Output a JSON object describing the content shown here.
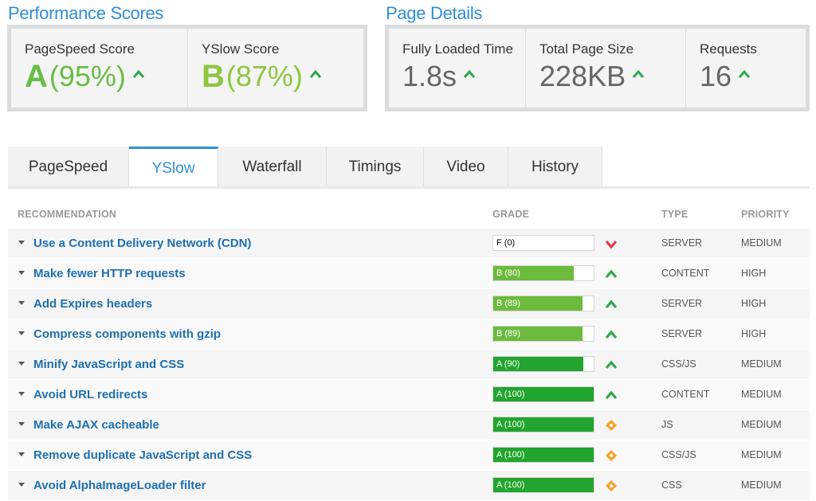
{
  "performance": {
    "title": "Performance Scores",
    "pagespeed": {
      "label": "PageSpeed Score",
      "grade": "A",
      "percent": "(95%)"
    },
    "yslow": {
      "label": "YSlow Score",
      "grade": "B",
      "percent": "(87%)"
    }
  },
  "details": {
    "title": "Page Details",
    "loaded": {
      "label": "Fully Loaded Time",
      "value": "1.8s"
    },
    "size": {
      "label": "Total Page Size",
      "value": "228KB"
    },
    "requests": {
      "label": "Requests",
      "value": "16"
    }
  },
  "tabs": [
    "PageSpeed",
    "YSlow",
    "Waterfall",
    "Timings",
    "Video",
    "History"
  ],
  "active_tab": "YSlow",
  "table": {
    "headers": {
      "recommendation": "RECOMMENDATION",
      "grade": "GRADE",
      "type": "TYPE",
      "priority": "PRIORITY"
    },
    "rows": [
      {
        "rec": "Use a Content Delivery Network (CDN)",
        "grade": "F (0)",
        "score": 0,
        "status": "down",
        "type": "SERVER",
        "priority": "MEDIUM"
      },
      {
        "rec": "Make fewer HTTP requests",
        "grade": "B (80)",
        "score": 80,
        "status": "up",
        "type": "CONTENT",
        "priority": "HIGH"
      },
      {
        "rec": "Add Expires headers",
        "grade": "B (89)",
        "score": 89,
        "status": "up",
        "type": "SERVER",
        "priority": "HIGH"
      },
      {
        "rec": "Compress components with gzip",
        "grade": "B (89)",
        "score": 89,
        "status": "up",
        "type": "SERVER",
        "priority": "HIGH"
      },
      {
        "rec": "Minify JavaScript and CSS",
        "grade": "A (90)",
        "score": 90,
        "status": "up",
        "type": "CSS/JS",
        "priority": "MEDIUM"
      },
      {
        "rec": "Avoid URL redirects",
        "grade": "A (100)",
        "score": 100,
        "status": "up",
        "type": "CONTENT",
        "priority": "MEDIUM"
      },
      {
        "rec": "Make AJAX cacheable",
        "grade": "A (100)",
        "score": 100,
        "status": "neutral",
        "type": "JS",
        "priority": "MEDIUM"
      },
      {
        "rec": "Remove duplicate JavaScript and CSS",
        "grade": "A (100)",
        "score": 100,
        "status": "neutral",
        "type": "CSS/JS",
        "priority": "MEDIUM"
      },
      {
        "rec": "Avoid AlphaImageLoader filter",
        "grade": "A (100)",
        "score": 100,
        "status": "neutral",
        "type": "CSS",
        "priority": "MEDIUM"
      }
    ]
  },
  "colors": {
    "accent": "#2f8fd6",
    "grade_a": "#22a52e",
    "grade_b": "#6cbb3c",
    "up": "#2ea84a",
    "down": "#e0394e",
    "neutral": "#f4a327"
  },
  "icons": {
    "up": "chevron-up-icon",
    "down": "chevron-down-icon",
    "neutral": "diamond-icon"
  }
}
